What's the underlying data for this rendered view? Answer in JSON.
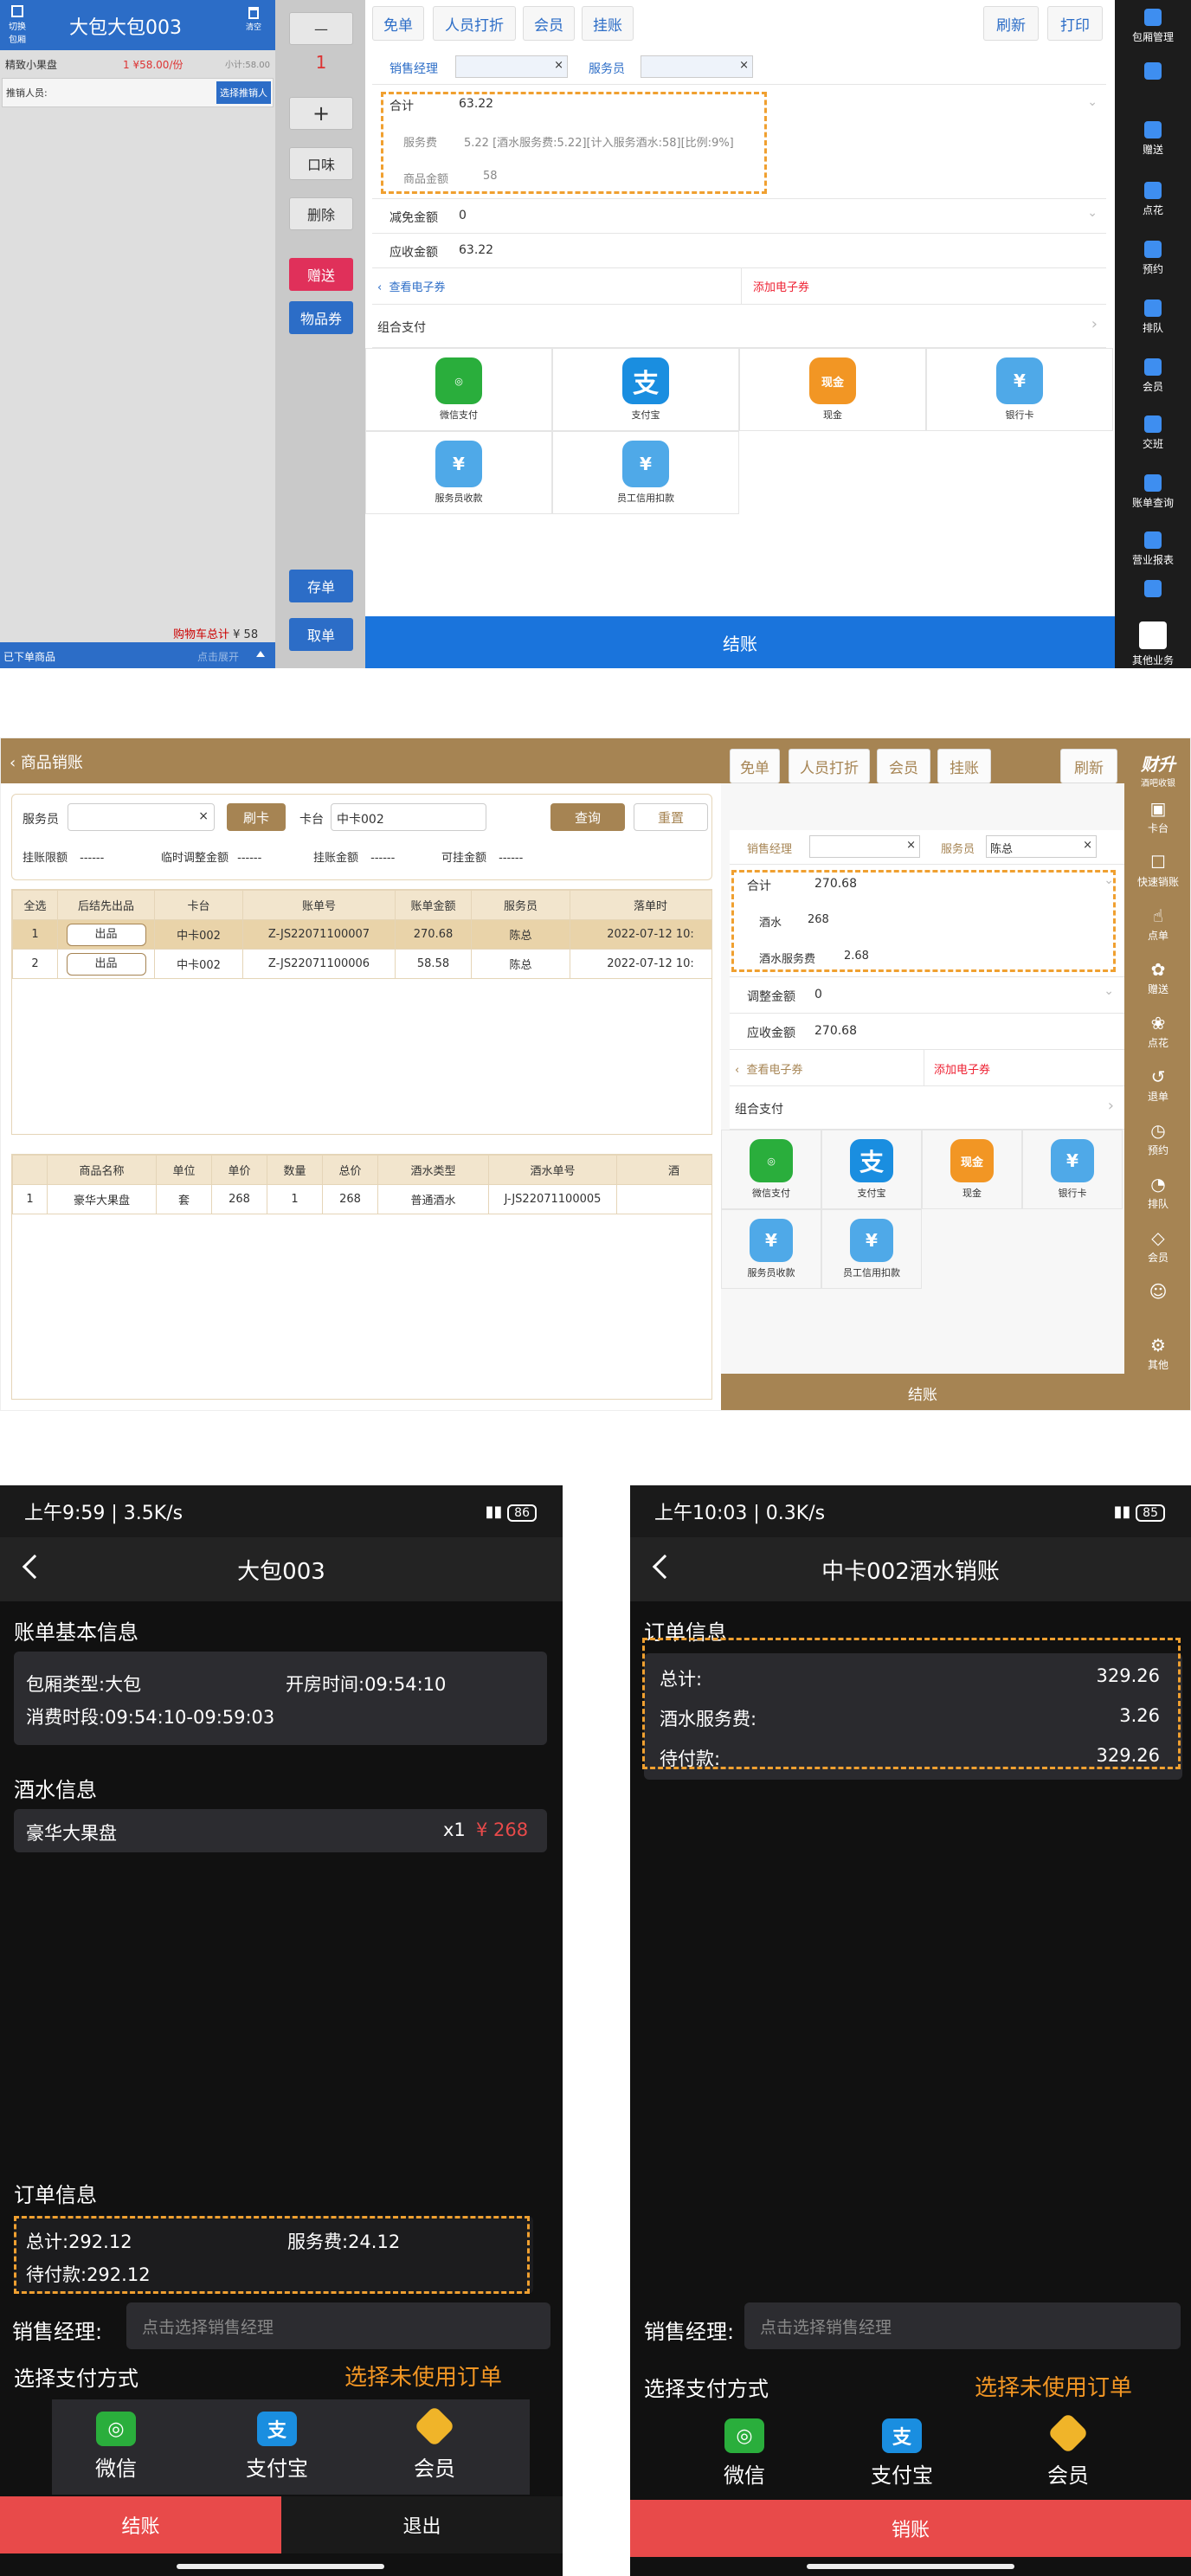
{
  "screen1": {
    "room_title": "大包大包003",
    "top_left_label": "切换包厢",
    "clear_label": "清空",
    "item_name": "精致小果盘",
    "item_qty_price": "1 ¥58.00/份",
    "item_subtotal": "小计:58.00",
    "recommender_label": "推销人员:",
    "select_recommender": "选择推销人",
    "cart_total_label": "购物车总计",
    "cart_total": "¥ 58",
    "ordered_label": "已下单商品",
    "expand_label": "点击展开",
    "minus": "—",
    "qty": "1",
    "plus": "+",
    "flavor": "口味",
    "delete": "删除",
    "gift": "赠送",
    "voucher": "物品券",
    "save": "存单",
    "take": "取单",
    "toolbar": [
      "免单",
      "人员打折",
      "会员",
      "挂账"
    ],
    "refresh": "刷新",
    "print": "打印",
    "sales_manager": "销售经理",
    "waiter": "服务员",
    "total_label": "合计",
    "total": "63.22",
    "service_fee_label": "服务费",
    "service_fee": "5.22 [酒水服务费:5.22][计入服务酒水:58][比例:9%]",
    "goods_amount_label": "商品金额",
    "goods_amount": "58",
    "discount_label": "减免金额",
    "discount": "0",
    "payable_label": "应收金额",
    "payable": "63.22",
    "view_coupon": "查看电子券",
    "add_coupon": "添加电子券",
    "combo_pay": "组合支付",
    "pay": [
      "微信支付",
      "支付宝",
      "现金",
      "银行卡",
      "服务员收款",
      "员工信用扣款"
    ],
    "checkout": "结账",
    "side": [
      "包厢管理",
      "",
      "赠送",
      "点花",
      "预约",
      "排队",
      "会员",
      "交班",
      "账单查询",
      "营业报表",
      "",
      "其他业务"
    ]
  },
  "screen2": {
    "title": "商品销账",
    "logo": "财升",
    "logo_sub": "酒吧收银",
    "waiter_label": "服务员",
    "swipe": "刷卡",
    "card_label": "卡台",
    "card_value": "中卡002",
    "query": "查询",
    "reset": "重置",
    "limit_label": "挂账限额",
    "limit": "------",
    "temp_adjust_label": "临时调整金额",
    "temp_adjust": "------",
    "hang_amount_label": "挂账金额",
    "hang_amount": "------",
    "can_hang_label": "可挂金额",
    "can_hang": "------",
    "table_headers": [
      "全选",
      "后结先出品",
      "卡台",
      "账单号",
      "账单金额",
      "服务员",
      "落单时"
    ],
    "rows": [
      [
        "1",
        "出品",
        "中卡002",
        "Z-JS22071100007",
        "270.68",
        "陈总",
        "2022-07-12 10:"
      ],
      [
        "2",
        "出品",
        "中卡002",
        "Z-JS22071100006",
        "58.58",
        "陈总",
        "2022-07-12 10:"
      ]
    ],
    "item_headers": [
      "",
      "商品名称",
      "单位",
      "单价",
      "数量",
      "总价",
      "酒水类型",
      "酒水单号",
      "酒"
    ],
    "items": [
      [
        "1",
        "豪华大果盘",
        "套",
        "268",
        "1",
        "268",
        "普通酒水",
        "J-JS22071100005",
        ""
      ]
    ],
    "toolbar": [
      "免单",
      "人员打折",
      "会员",
      "挂账"
    ],
    "refresh": "刷新",
    "sales_manager": "销售经理",
    "waiter": "服务员",
    "waiter_value": "陈总",
    "total_label": "合计",
    "total": "270.68",
    "wine_label": "酒水",
    "wine": "268",
    "wine_fee_label": "酒水服务费",
    "wine_fee": "2.68",
    "discount_label": "调整金额",
    "discount": "0",
    "payable_label": "应收金额",
    "payable": "270.68",
    "view_coupon": "查看电子券",
    "add_coupon": "添加电子券",
    "combo_pay": "组合支付",
    "pay": [
      "微信支付",
      "支付宝",
      "现金",
      "银行卡",
      "服务员收款",
      "员工信用扣款"
    ],
    "checkout": "结账",
    "side": [
      "卡台",
      "快速销账",
      "点单",
      "赠送",
      "点花",
      "退单",
      "预约",
      "排队",
      "会员",
      "",
      "其他"
    ]
  },
  "phone1": {
    "time": "上午9:59 | 3.5K/s",
    "battery": "86",
    "title": "大包003",
    "basic_section": "账单基本信息",
    "room_type": "包厢类型:大包",
    "open_time": "开房时间:09:54:10",
    "period": "消费时段:09:54:10-09:59:03",
    "wine_section": "酒水信息",
    "wine_item": "豪华大果盘",
    "wine_qty": "x1",
    "wine_price": "¥ 268",
    "order_section": "订单信息",
    "total": "总计:292.12",
    "service": "服务费:24.12",
    "pending": "待付款:292.12",
    "sales_manager": "销售经理:",
    "sales_placeholder": "点击选择销售经理",
    "pay_method": "选择支付方式",
    "unused_order": "选择未使用订单",
    "pay": [
      "微信",
      "支付宝",
      "会员"
    ],
    "checkout": "结账",
    "exit": "退出"
  },
  "phone2": {
    "time": "上午10:03 | 0.3K/s",
    "battery": "85",
    "title": "中卡002酒水销账",
    "order_section": "订单信息",
    "total_label": "总计:",
    "total": "329.26",
    "fee_label": "酒水服务费:",
    "fee": "3.26",
    "pending_label": "待付款:",
    "pending": "329.26",
    "sales_manager": "销售经理:",
    "sales_placeholder": "点击选择销售经理",
    "pay_method": "选择支付方式",
    "unused_order": "选择未使用订单",
    "pay": [
      "微信",
      "支付宝",
      "会员"
    ],
    "checkout": "销账"
  },
  "colors": {
    "blue": "#2c6dc7",
    "gold": "#a68453",
    "highlight": "#f0a030",
    "red": "#e84a4a",
    "wechat": "#2aae3c",
    "alipay": "#1a8ee0",
    "cash": "#f29624",
    "bank": "#4fa9e8",
    "member": "#f0b429"
  }
}
